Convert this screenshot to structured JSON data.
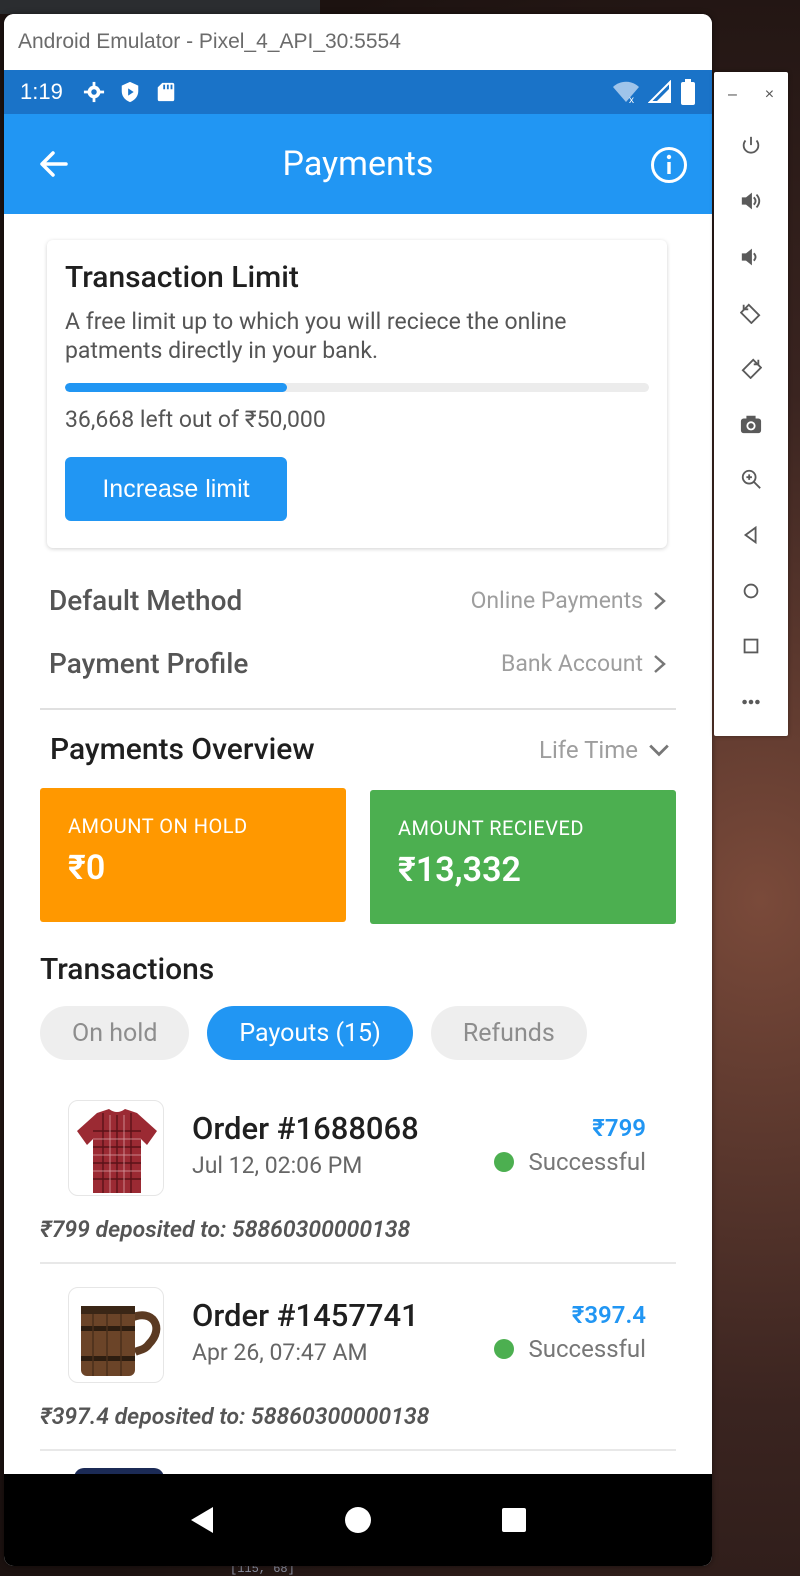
{
  "window": {
    "title": "Android Emulator - Pixel_4_API_30:5554"
  },
  "statusbar": {
    "time": "1:19"
  },
  "appbar": {
    "title": "Payments"
  },
  "limit_card": {
    "title": "Transaction Limit",
    "description": "A free limit up to which you will reciece the online patments directly in your bank.",
    "progress_fraction": 0.38,
    "remaining_text": "36,668 left out of ₹50,000",
    "button_label": "Increase limit"
  },
  "settings": {
    "default_method": {
      "label": "Default Method",
      "value": "Online Payments"
    },
    "payment_profile": {
      "label": "Payment Profile",
      "value": "Bank Account"
    }
  },
  "overview": {
    "title": "Payments Overview",
    "range": "Life Time",
    "on_hold": {
      "label": "AMOUNT ON HOLD",
      "value": "₹0",
      "color": "#ff9800"
    },
    "received": {
      "label": "AMOUNT RECIEVED",
      "value": "₹13,332",
      "color": "#4caf50"
    }
  },
  "transactions": {
    "title": "Transactions",
    "tabs": [
      {
        "label": "On hold",
        "active": false
      },
      {
        "label": "Payouts (15)",
        "active": true
      },
      {
        "label": "Refunds",
        "active": false
      }
    ],
    "orders": [
      {
        "name": "Order #1688068",
        "date": "Jul 12, 02:06 PM",
        "amount": "₹799",
        "status": "Successful",
        "deposit": "₹799 deposited to: 58860300000138",
        "thumb": "shirt-icon"
      },
      {
        "name": "Order #1457741",
        "date": "Apr 26, 07:47 AM",
        "amount": "₹397.4",
        "status": "Successful",
        "deposit": "₹397.4 deposited to: 58860300000138",
        "thumb": "mug-icon"
      }
    ]
  },
  "side_panel": {
    "minimize": "–",
    "close": "×"
  },
  "colors": {
    "accent": "#2196f3",
    "statusbar": "#1a73c8"
  },
  "background": {
    "code_text": "[115, 68]"
  }
}
